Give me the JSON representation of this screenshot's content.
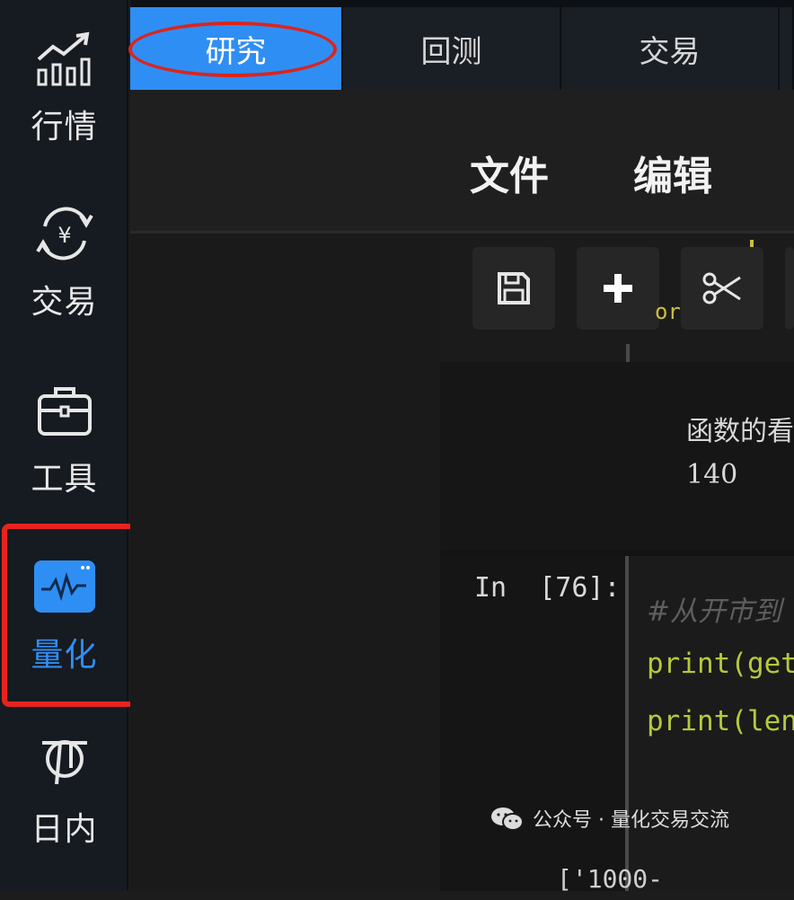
{
  "sidebar": {
    "items": [
      {
        "label": "行情",
        "icon": "chart-trend-icon"
      },
      {
        "label": "交易",
        "icon": "yen-exchange-icon"
      },
      {
        "label": "工具",
        "icon": "toolbox-icon"
      },
      {
        "label": "量化",
        "icon": "quant-waveform-icon",
        "active": true
      },
      {
        "label": "日内",
        "icon": "intraday-icon"
      }
    ],
    "accent_color": "#2f8ef4",
    "highlight_color": "#e8231f"
  },
  "tabs": [
    {
      "label": "研究",
      "active": true
    },
    {
      "label": "回测"
    },
    {
      "label": "交易"
    }
  ],
  "menu": {
    "file_label": "文件",
    "edit_label": "编辑"
  },
  "toolbar": {
    "buttons": [
      "save-icon",
      "add-icon",
      "cut-icon"
    ]
  },
  "notebook": {
    "stray_text": "or",
    "output_line1": "函数的看",
    "output_line2": "140",
    "in_prompt": "In  [76]:",
    "code_comment": "#从开市到",
    "code_line1": "print(get",
    "code_line2": "print(len",
    "trailing_output": "['1000-"
  },
  "watermark": {
    "text": "公众号 · 量化交易交流"
  }
}
